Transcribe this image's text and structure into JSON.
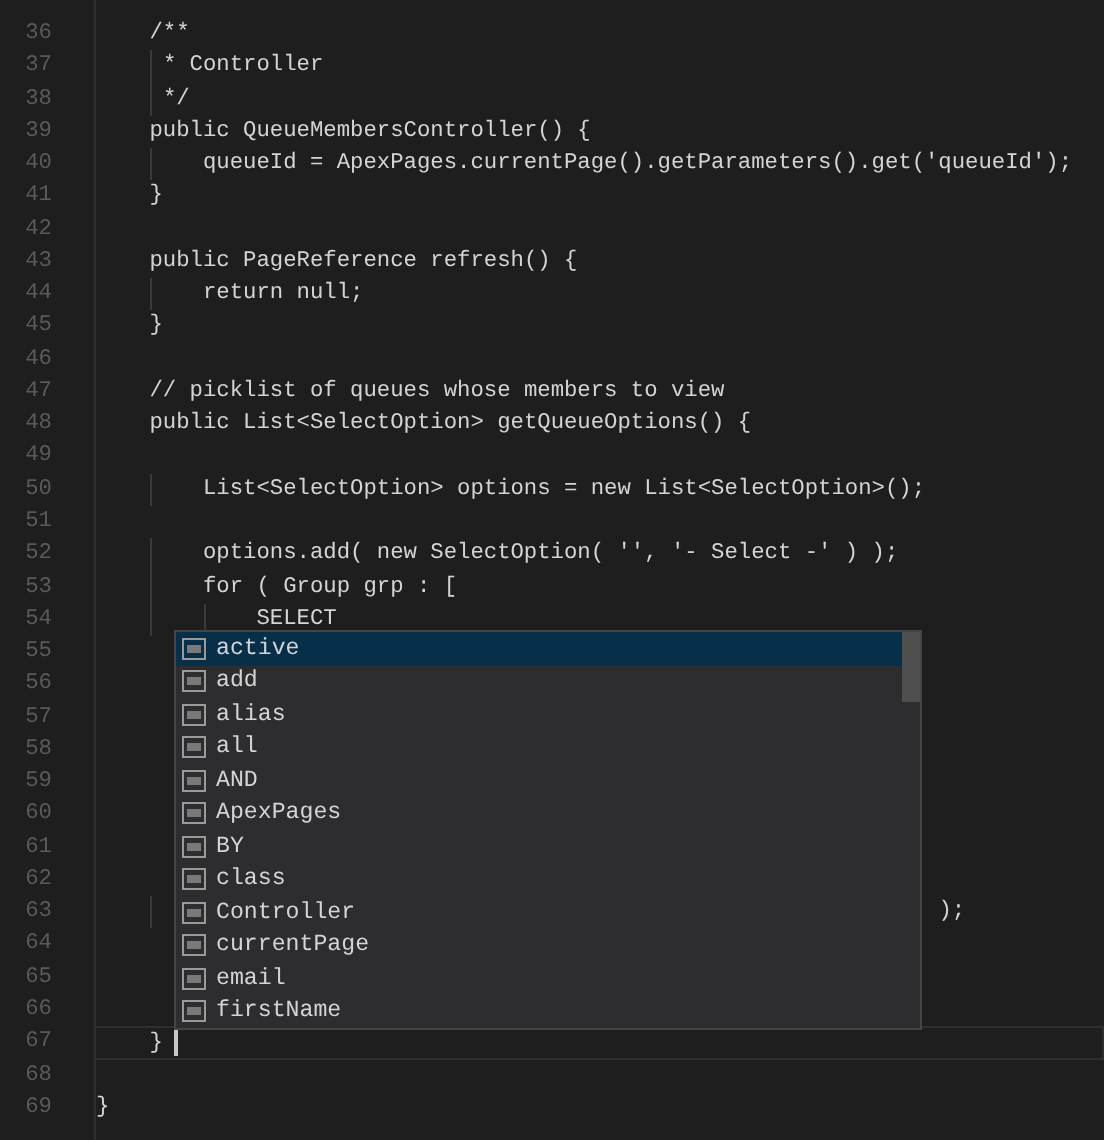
{
  "editor": {
    "lines": [
      {
        "number": "36",
        "text": "    /**",
        "current": false
      },
      {
        "number": "37",
        "text": "     * Controller",
        "current": false
      },
      {
        "number": "38",
        "text": "     */",
        "current": false
      },
      {
        "number": "39",
        "text": "    public QueueMembersController() {",
        "current": false
      },
      {
        "number": "40",
        "text": "        queueId = ApexPages.currentPage().getParameters().get('queueId');",
        "current": false
      },
      {
        "number": "41",
        "text": "    }",
        "current": false
      },
      {
        "number": "42",
        "current": false
      },
      {
        "number": "43",
        "text": "    public PageReference refresh() {",
        "current": false
      },
      {
        "number": "44",
        "text": "        return null;",
        "current": false
      },
      {
        "number": "45",
        "text": "    }",
        "current": false
      },
      {
        "number": "46",
        "current": false
      },
      {
        "number": "47",
        "text": "    // picklist of queues whose members to view",
        "current": false
      },
      {
        "number": "48",
        "text": "    public List<SelectOption> getQueueOptions() {",
        "current": false
      },
      {
        "number": "49",
        "current": false
      },
      {
        "number": "50",
        "text": "        List<SelectOption> options = new List<SelectOption>();",
        "current": false
      },
      {
        "number": "51",
        "current": false
      },
      {
        "number": "52",
        "text": "        options.add( new SelectOption( '', '- Select -' ) );",
        "current": false
      },
      {
        "number": "53",
        "text": "        for ( Group grp : [",
        "current": false
      },
      {
        "number": "54",
        "text": "            SELECT",
        "current": false
      },
      {
        "number": "55",
        "current": false
      },
      {
        "number": "56",
        "current": false
      },
      {
        "number": "57",
        "current": false
      },
      {
        "number": "58",
        "current": false
      },
      {
        "number": "59",
        "current": false
      },
      {
        "number": "60",
        "current": false
      },
      {
        "number": "61",
        "current": false
      },
      {
        "number": "62",
        "current": false
      },
      {
        "number": "63",
        "text": "                                                               );",
        "current": false
      },
      {
        "number": "64",
        "current": false
      },
      {
        "number": "65",
        "current": false
      },
      {
        "number": "66",
        "current": false
      },
      {
        "number": "67",
        "text": "    }",
        "current": true
      },
      {
        "number": "68",
        "current": false
      },
      {
        "number": "69",
        "text": "}",
        "current": false
      }
    ]
  },
  "suggestions": {
    "items": [
      {
        "label": "active",
        "selected": true
      },
      {
        "label": "add",
        "selected": false
      },
      {
        "label": "alias",
        "selected": false
      },
      {
        "label": "all",
        "selected": false
      },
      {
        "label": "AND",
        "selected": false
      },
      {
        "label": "ApexPages",
        "selected": false
      },
      {
        "label": "BY",
        "selected": false
      },
      {
        "label": "class",
        "selected": false
      },
      {
        "label": "Controller",
        "selected": false
      },
      {
        "label": "currentPage",
        "selected": false
      },
      {
        "label": "email",
        "selected": false
      },
      {
        "label": "firstName",
        "selected": false
      }
    ]
  }
}
